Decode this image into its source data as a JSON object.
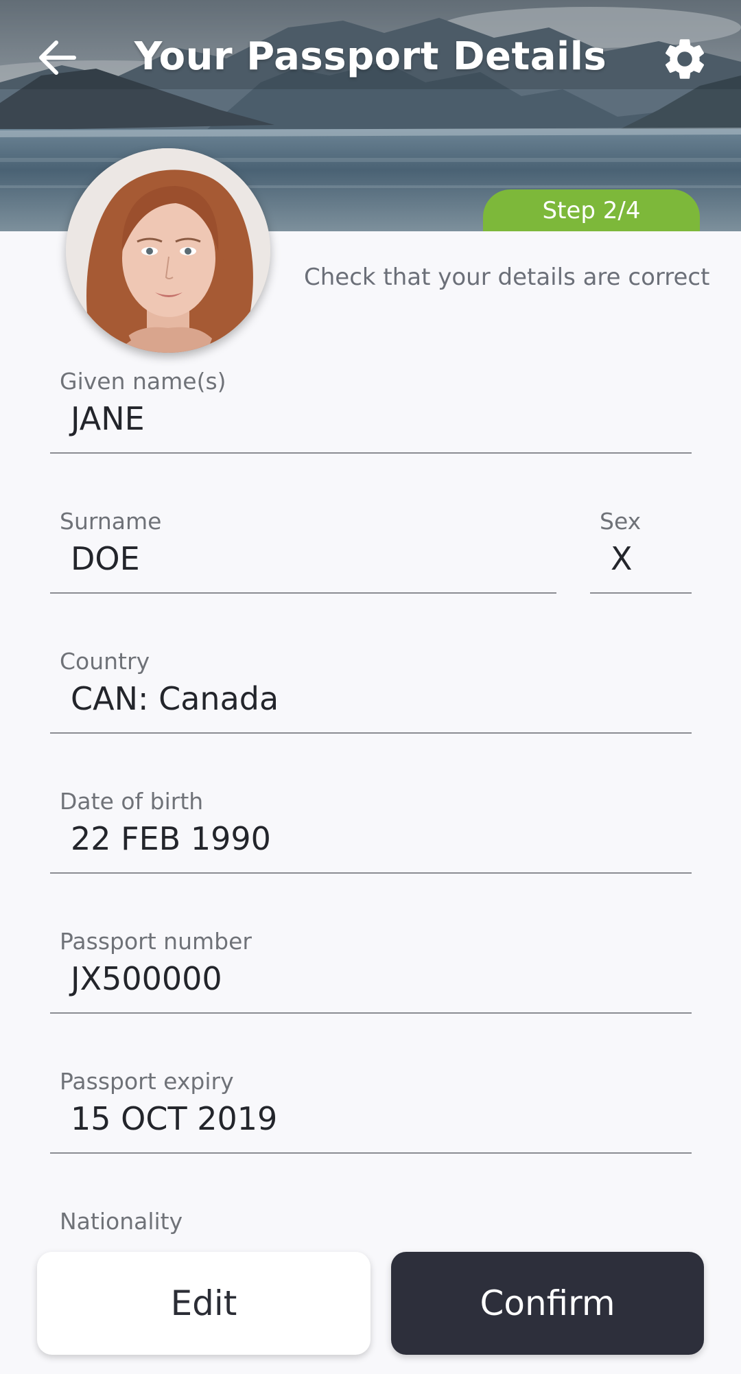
{
  "header": {
    "title": "Your Passport Details",
    "back_icon": "arrow-left-icon",
    "settings_icon": "gear-icon"
  },
  "step": {
    "label": "Step 2/4",
    "current": 2,
    "total": 4
  },
  "instruction": "Check that your details are correct",
  "fields": {
    "given_names": {
      "label": "Given name(s)",
      "value": "JANE"
    },
    "surname": {
      "label": "Surname",
      "value": "DOE"
    },
    "sex": {
      "label": "Sex",
      "value": "X"
    },
    "country": {
      "label": "Country",
      "value": "CAN: Canada"
    },
    "dob": {
      "label": "Date of birth",
      "value": "22 FEB 1990"
    },
    "passport_number": {
      "label": "Passport number",
      "value": "JX500000"
    },
    "passport_expiry": {
      "label": "Passport expiry",
      "value": "15 OCT 2019"
    },
    "nationality": {
      "label": "Nationality"
    }
  },
  "actions": {
    "edit": "Edit",
    "confirm": "Confirm"
  },
  "colors": {
    "step_green": "#7db83a",
    "confirm_bg": "#2d2f3b",
    "background": "#f8f8fb",
    "label": "#6f7278",
    "value": "#23252b"
  }
}
